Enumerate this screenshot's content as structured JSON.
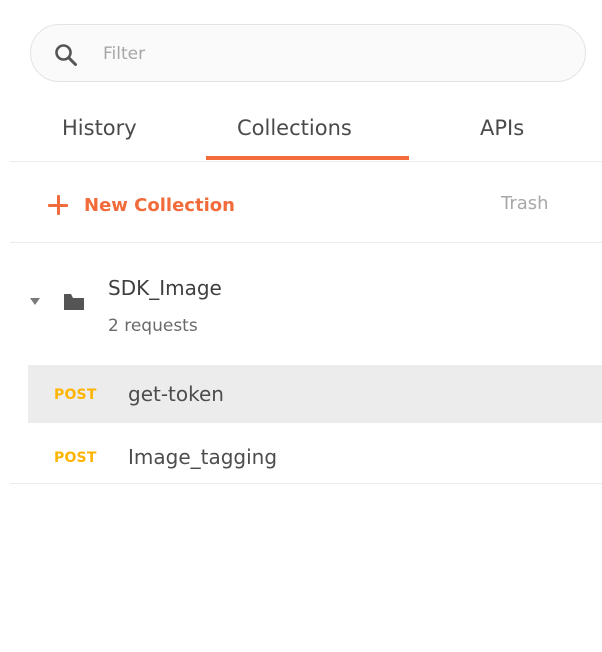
{
  "search": {
    "placeholder": "Filter",
    "icon": "search-icon"
  },
  "tabs": [
    {
      "label": "History",
      "active": false
    },
    {
      "label": "Collections",
      "active": true
    },
    {
      "label": "APIs",
      "active": false
    }
  ],
  "actions": {
    "new_collection_label": "New Collection",
    "trash_label": "Trash"
  },
  "collection": {
    "name": "SDK_Image",
    "meta": "2 requests",
    "expanded": true,
    "requests": [
      {
        "method": "POST",
        "name": "get-token",
        "selected": true
      },
      {
        "method": "POST",
        "name": "Image_tagging",
        "selected": false
      }
    ]
  },
  "colors": {
    "accent": "#f26b3a",
    "method_post": "#ffb400",
    "selected_row": "#ececec"
  }
}
